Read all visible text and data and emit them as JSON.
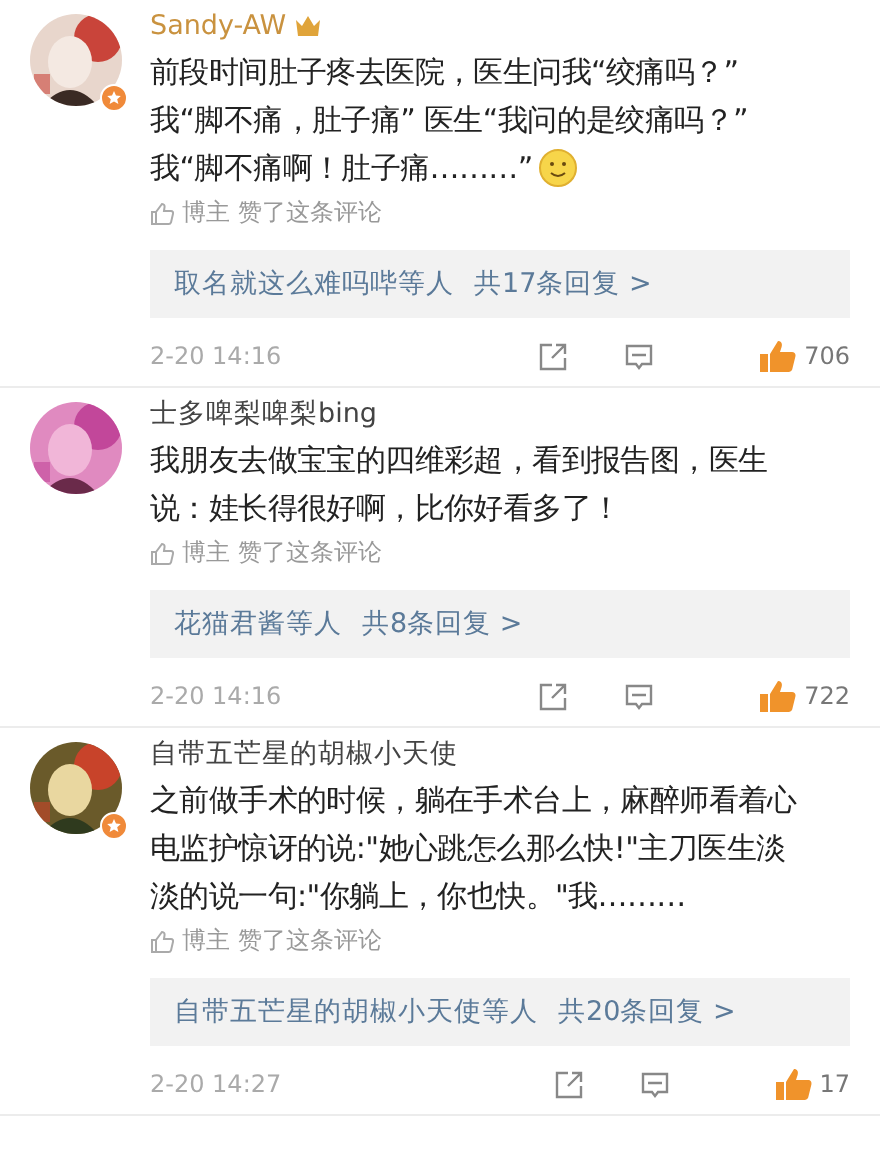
{
  "comments": [
    {
      "name": "Sandy-AW",
      "vip": true,
      "verified": true,
      "avatar": {
        "kind": "picture"
      },
      "text_lines": [
        "前段时间肚子疼去医院，医生问我“绞痛吗？”",
        "我“脚不痛，肚子痛” 医生“我问的是绞痛吗？”",
        "我“脚不痛啊！肚子痛………”"
      ],
      "emoji": true,
      "liked_by": "博主",
      "liked_text": "赞了这条评论",
      "reply_users": "取名就这么难吗哔等人",
      "reply_count": "共17条回复 >",
      "time": "2-20 14:16",
      "likes": "706"
    },
    {
      "name": "士多啤梨啤梨bing",
      "vip": false,
      "verified": false,
      "avatar": {
        "kind": "picture"
      },
      "text_lines": [
        "我朋友去做宝宝的四维彩超，看到报告图，医生",
        "说：娃长得很好啊，比你好看多了！"
      ],
      "emoji": false,
      "liked_by": "博主",
      "liked_text": "赞了这条评论",
      "reply_users": "花猫君酱等人",
      "reply_count": "共8条回复 >",
      "time": "2-20 14:16",
      "likes": "722"
    },
    {
      "name": "自带五芒星的胡椒小天使",
      "vip": false,
      "verified": true,
      "avatar": {
        "kind": "picture"
      },
      "text_lines": [
        "之前做手术的时候，躺在手术台上，麻醉师看着心",
        "电监护惊讶的说:\"她心跳怎么那么快!\"主刀医生淡",
        "淡的说一句:\"你躺上，你也快。\"我………"
      ],
      "emoji": false,
      "liked_by": "博主",
      "liked_text": "赞了这条评论",
      "reply_users": "自带五芒星的胡椒小天使等人",
      "reply_count": "共20条回复 >",
      "time": "2-20 14:27",
      "likes": "17"
    }
  ]
}
